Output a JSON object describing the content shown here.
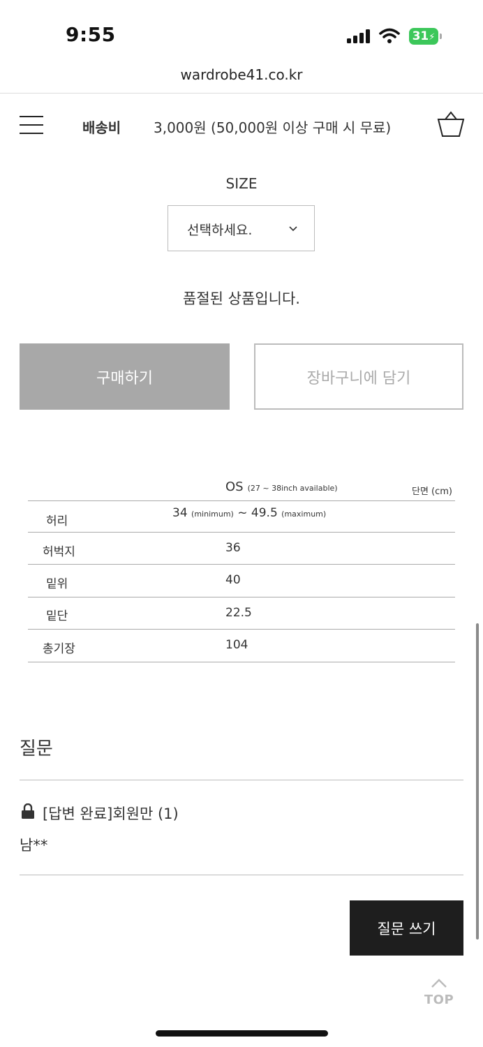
{
  "status_bar": {
    "time": "9:55",
    "battery": "31",
    "battery_color": "#3cc75a"
  },
  "browser": {
    "url": "wardrobe41.co.kr"
  },
  "header": {
    "menu_icon": "hamburger-menu-icon",
    "shipping_label": "배송비",
    "shipping_value": "3,000원 (50,000원 이상 구매 시 무료)",
    "cart_icon": "shopping-bag-icon"
  },
  "option": {
    "label": "SIZE",
    "selected": "선택하세요."
  },
  "soldout_message": "품절된 상품입니다.",
  "actions": {
    "buy_label": "구매하기",
    "cart_label": "장바구니에 담기"
  },
  "size_table": {
    "column_header": "OS",
    "column_note": "(27 ~ 38inch available)",
    "unit": "단면 (cm)",
    "rows": [
      {
        "label": "허리",
        "value": "34",
        "min_note": "(minimum)",
        "sep": "~",
        "value2": "49.5",
        "max_note": "(maximum)"
      },
      {
        "label": "허벅지",
        "value": "36"
      },
      {
        "label": "밑위",
        "value": "40"
      },
      {
        "label": "밑단",
        "value": "22.5"
      },
      {
        "label": "총기장",
        "value": "104"
      }
    ]
  },
  "questions": {
    "title": "질문",
    "items": [
      {
        "title": "[답변 완료]회원만 (1)",
        "author": "남**",
        "icon": "lock-icon"
      }
    ],
    "write_label": "질문 쓰기"
  },
  "scroll_top_label": "TOP"
}
